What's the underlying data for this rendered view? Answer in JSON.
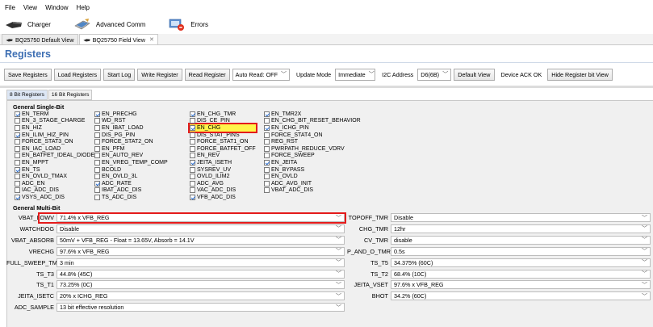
{
  "menu": [
    "File",
    "View",
    "Window",
    "Help"
  ],
  "toolbar": [
    {
      "label": "Charger",
      "icon": "charger-icon"
    },
    {
      "label": "Advanced Comm",
      "icon": "advanced-comm-icon"
    },
    {
      "label": "Errors",
      "icon": "errors-icon"
    }
  ],
  "view_tabs": [
    "BQ25750 Default View",
    "BQ25750 Field View"
  ],
  "page_title": "Registers",
  "buttons": {
    "save": "Save Registers",
    "load": "Load Registers",
    "start_log": "Start Log",
    "write": "Write Register",
    "read": "Read Register",
    "auto_read": "Auto Read: OFF",
    "update_mode_label": "Update Mode",
    "update_mode_value": "Immediate",
    "i2c_label": "I2C Address",
    "i2c_value": "D6(6B)",
    "default_view": "Default View",
    "ack_status": "Device ACK OK",
    "hide_bit_view": "Hide Register bit View"
  },
  "bit_tabs": [
    "8 Bit Registers",
    "16 Bit Registers"
  ],
  "single_bit": {
    "title": "General Single-Bit",
    "columns": [
      [
        {
          "label": "EN_TERM",
          "checked": true
        },
        {
          "label": "EN_3_STAGE_CHARGE",
          "checked": false
        },
        {
          "label": "EN_HIZ",
          "checked": false
        },
        {
          "label": "EN_ILIM_HIZ_PIN",
          "checked": true
        },
        {
          "label": "FORCE_STAT3_ON",
          "checked": false
        },
        {
          "label": "EN_IAC_LOAD",
          "checked": false
        },
        {
          "label": "EN_BATFET_IDEAL_DIODE",
          "checked": false
        },
        {
          "label": "EN_MPPT",
          "checked": false
        },
        {
          "label": "EN_TS",
          "checked": true
        },
        {
          "label": "EN_OVLD_TMAX",
          "checked": false
        },
        {
          "label": "ADC_EN",
          "checked": false
        },
        {
          "label": "IAC_ADC_DIS",
          "checked": false
        },
        {
          "label": "VSYS_ADC_DIS",
          "checked": true
        }
      ],
      [
        {
          "label": "EN_PRECHG",
          "checked": true
        },
        {
          "label": "WD_RST",
          "checked": false
        },
        {
          "label": "EN_IBAT_LOAD",
          "checked": false
        },
        {
          "label": "DIS_PG_PIN",
          "checked": false
        },
        {
          "label": "FORCE_STAT2_ON",
          "checked": false
        },
        {
          "label": "EN_PFM",
          "checked": false
        },
        {
          "label": "EN_AUTO_REV",
          "checked": false
        },
        {
          "label": "EN_VREG_TEMP_COMP",
          "checked": false
        },
        {
          "label": "BCOLD",
          "checked": false
        },
        {
          "label": "EN_OVLD_3L",
          "checked": false
        },
        {
          "label": "ADC_RATE",
          "checked": true
        },
        {
          "label": "IBAT_ADC_DIS",
          "checked": false
        },
        {
          "label": "TS_ADC_DIS",
          "checked": false
        }
      ],
      [
        {
          "label": "EN_CHG_TMR",
          "checked": true
        },
        {
          "label": "DIS_CE_PIN",
          "checked": false
        },
        {
          "label": "EN_CHG",
          "checked": true,
          "highlight": true
        },
        {
          "label": "DIS_STAT_PINS",
          "checked": false
        },
        {
          "label": "FORCE_STAT1_ON",
          "checked": false
        },
        {
          "label": "FORCE_BATFET_OFF",
          "checked": false
        },
        {
          "label": "EN_REV",
          "checked": false
        },
        {
          "label": "JEITA_ISETH",
          "checked": true
        },
        {
          "label": "SYSREV_UV",
          "checked": false
        },
        {
          "label": "OVLD_ILIM2",
          "checked": false
        },
        {
          "label": "ADC_AVG",
          "checked": false
        },
        {
          "label": "VAC_ADC_DIS",
          "checked": false
        },
        {
          "label": "VFB_ADC_DIS",
          "checked": true
        }
      ],
      [
        {
          "label": "EN_TMR2X",
          "checked": true
        },
        {
          "label": "EN_CHG_BIT_RESET_BEHAVIOR",
          "checked": false
        },
        {
          "label": "EN_ICHG_PIN",
          "checked": true
        },
        {
          "label": "FORCE_STAT4_ON",
          "checked": false
        },
        {
          "label": "REG_RST",
          "checked": false
        },
        {
          "label": "PWRPATH_REDUCE_VDRV",
          "checked": false
        },
        {
          "label": "FORCE_SWEEP",
          "checked": false
        },
        {
          "label": "EN_JEITA",
          "checked": true
        },
        {
          "label": "EN_BYPASS",
          "checked": false
        },
        {
          "label": "EN_OVLD",
          "checked": false
        },
        {
          "label": "ADC_AVG_INIT",
          "checked": false
        },
        {
          "label": "VBAT_ADC_DIS",
          "checked": false
        }
      ]
    ]
  },
  "multi_bit": {
    "title": "General Multi-Bit",
    "left": [
      {
        "label": "VBAT_LOWV",
        "value": "71.4% x VFB_REG"
      },
      {
        "label": "WATCHDOG",
        "value": "Disable",
        "highlight": true
      },
      {
        "label": "VBAT_ABSORB",
        "value": "50mV + VFB_REG - Float = 13.65V, Absorb = 14.1V"
      },
      {
        "label": "VRECHG",
        "value": "97.6% x VFB_REG"
      },
      {
        "label": "FULL_SWEEP_TMR",
        "value": "3 min"
      },
      {
        "label": "TS_T3",
        "value": "44.8% (45C)"
      },
      {
        "label": "TS_T1",
        "value": "73.25% (0C)"
      },
      {
        "label": "JEITA_ISETC",
        "value": "20% x ICHG_REG"
      },
      {
        "label": "ADC_SAMPLE",
        "value": "13 bit effective resolution"
      }
    ],
    "right": [
      {
        "label": "TOPOFF_TMR",
        "value": "Disable"
      },
      {
        "label": "CHG_TMR",
        "value": "12hr"
      },
      {
        "label": "CV_TMR",
        "value": "disable"
      },
      {
        "label": "P_AND_O_TMR",
        "value": "0.5s"
      },
      {
        "label": "TS_T5",
        "value": "34.375% (60C)"
      },
      {
        "label": "TS_T2",
        "value": "68.4% (10C)"
      },
      {
        "label": "JEITA_VSET",
        "value": "97.6% x VFB_REG"
      },
      {
        "label": "BHOT",
        "value": "34.2% (60C)"
      }
    ]
  }
}
